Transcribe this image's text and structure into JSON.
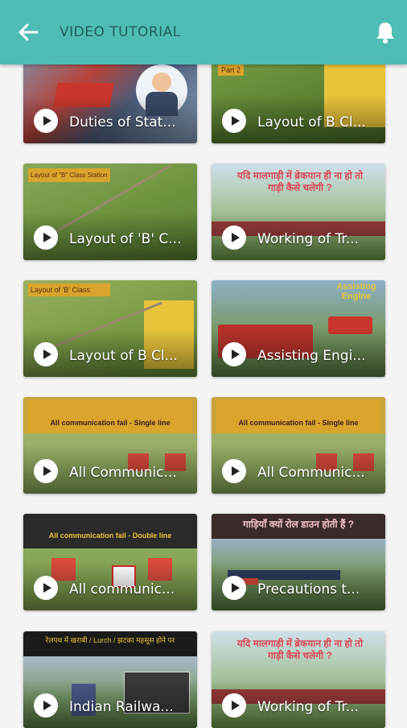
{
  "header": {
    "title": "VIDEO TUTORIAL",
    "back_icon": "arrow-left-icon",
    "bell_icon": "bell-icon",
    "bar_color": "#4fbdb5"
  },
  "videos": [
    {
      "title": "Duties of Stat...",
      "thumb_text": ""
    },
    {
      "title": "Layout of B Cl...",
      "thumb_text": "Part 2"
    },
    {
      "title": "Layout of 'B' C...",
      "thumb_text": "Layout of \"B\" Class Station"
    },
    {
      "title": "Working of Tr...",
      "thumb_text": "यदि मालगाड़ी में ब्रेकयान ही ना हो तो गाड़ी कैसे चलेगी ?"
    },
    {
      "title": "Layout of B Cl...",
      "thumb_text": "Layout of 'B' Class"
    },
    {
      "title": "Assisting Engi...",
      "thumb_text": "Assisting Engine"
    },
    {
      "title": "All Communic...",
      "thumb_text": "All communication fail - Single line"
    },
    {
      "title": "All Communic...",
      "thumb_text": "All communication fail - Single line"
    },
    {
      "title": "All communic...",
      "thumb_text": "All communication fail - Double line"
    },
    {
      "title": "Precautions t...",
      "thumb_text": "गाड़ियाँ क्यों रोल डाउन होती हैं ?"
    },
    {
      "title": "Indian Railwa...",
      "thumb_text": "रेलपथ में खराबी / Lurch / झटका महसूस होने पर"
    },
    {
      "title": "Working of Tr...",
      "thumb_text": "यदि मालगाड़ी में ब्रेकयान ही ना हो तो गाड़ी कैसे चलेगी ?"
    }
  ]
}
